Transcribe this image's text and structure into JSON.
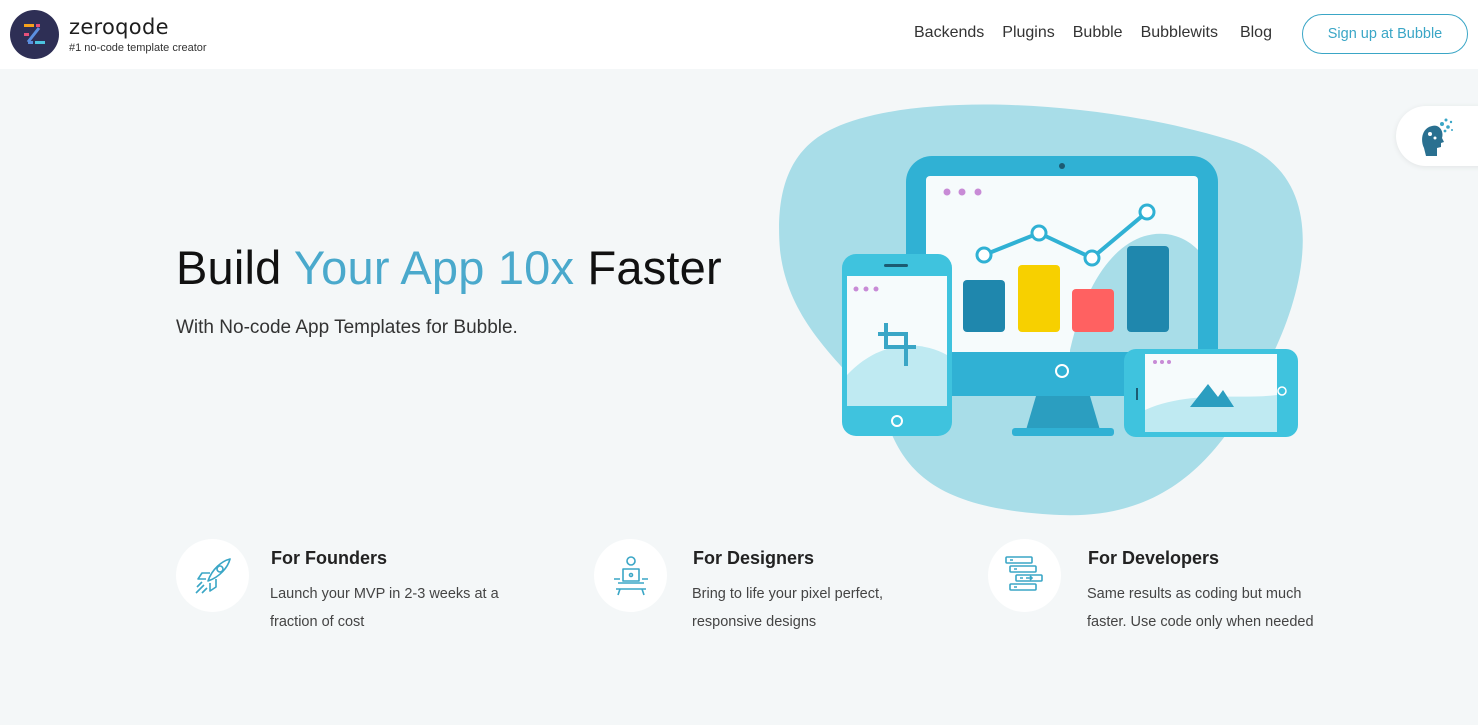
{
  "header": {
    "logo_name": "zeroqode",
    "logo_tagline": "#1 no-code template creator",
    "nav": [
      "Backends",
      "Plugins",
      "Bubble",
      "Bubblewits",
      "Blog"
    ],
    "signup_label": "Sign up at Bubble"
  },
  "hero": {
    "title_part1": "Build ",
    "title_accent": "Your App 10x",
    "title_part2": " Faster",
    "subtitle": "With No-code App Templates for Bubble."
  },
  "features": [
    {
      "icon": "rocket-icon",
      "title": "For Founders",
      "desc": "Launch your MVP in 2-3 weeks at a fraction of cost"
    },
    {
      "icon": "designer-laptop-icon",
      "title": "For Designers",
      "desc": "Bring to life your pixel perfect, responsive designs"
    },
    {
      "icon": "server-stack-icon",
      "title": "For Developers",
      "desc": "Same results as coding but much faster. Use code only when needed"
    }
  ],
  "colors": {
    "accent": "#4aa9cc",
    "background": "#f4f7f8",
    "logo_bg": "#2e2f55",
    "bar_blue": "#1f87ad",
    "bar_yellow": "#f7d000",
    "bar_red": "#ff6161"
  }
}
